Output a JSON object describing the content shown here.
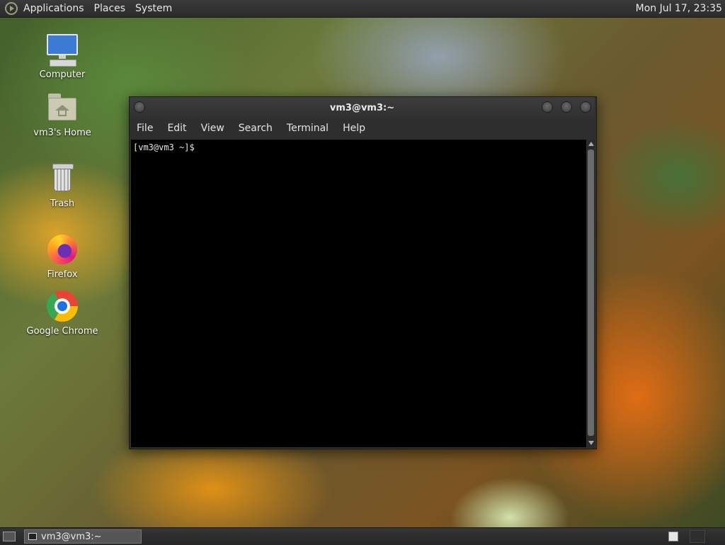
{
  "top_panel": {
    "menus": [
      "Applications",
      "Places",
      "System"
    ],
    "clock": "Mon Jul 17, 23:35"
  },
  "desktop": {
    "icons": [
      {
        "label": "Computer",
        "icon": "computer-icon"
      },
      {
        "label": "vm3's Home",
        "icon": "home-folder-icon"
      },
      {
        "label": "Trash",
        "icon": "trash-icon"
      },
      {
        "label": "Firefox",
        "icon": "firefox-icon"
      },
      {
        "label": "Google Chrome",
        "icon": "chrome-icon"
      }
    ]
  },
  "terminal": {
    "title": "vm3@vm3:~",
    "menus": [
      "File",
      "Edit",
      "View",
      "Search",
      "Terminal",
      "Help"
    ],
    "prompt": "[vm3@vm3 ~]$"
  },
  "taskbar": {
    "task_label": "vm3@vm3:~"
  }
}
